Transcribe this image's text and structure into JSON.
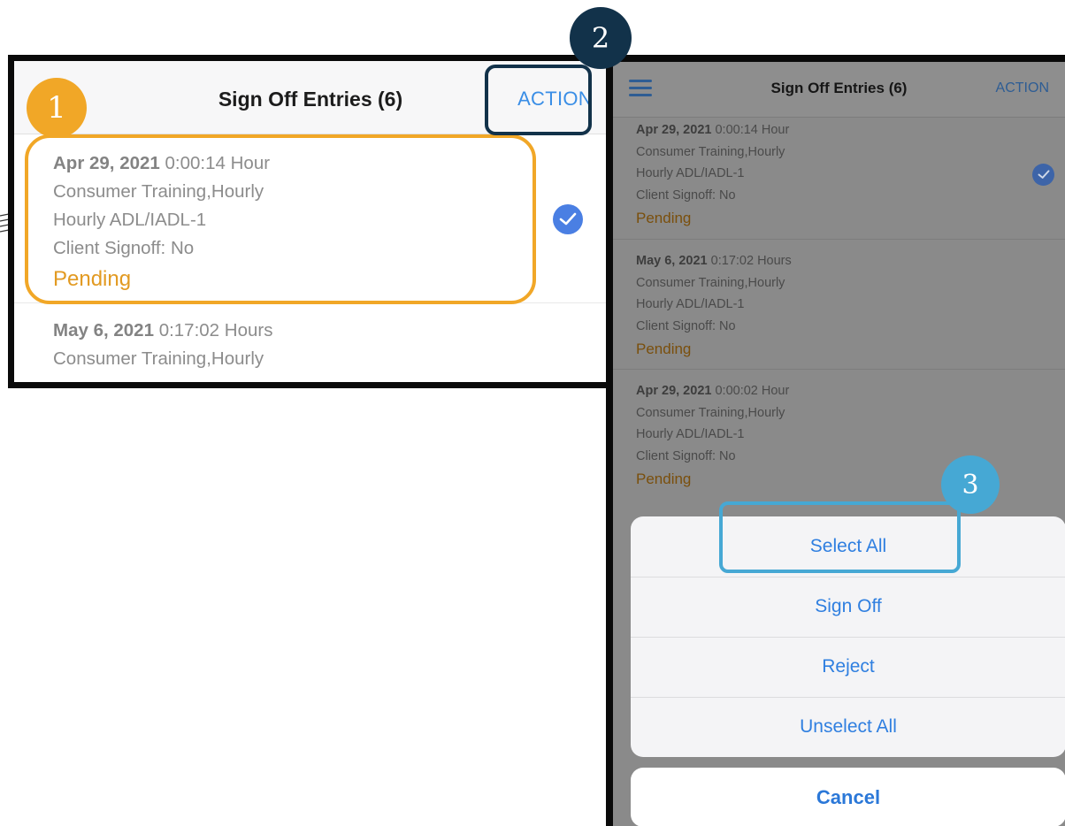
{
  "left_panel": {
    "title": "Sign Off Entries (6)",
    "action_label": "ACTION",
    "entries": [
      {
        "date": "Apr 29, 2021",
        "duration": "0:00:14 Hour",
        "line1": "Consumer Training,Hourly",
        "line2": "Hourly ADL/IADL-1",
        "line3": "Client Signoff: No",
        "status": "Pending"
      },
      {
        "date": "May 6, 2021",
        "duration": "0:17:02 Hours",
        "line1": "Consumer Training,Hourly"
      }
    ]
  },
  "right_panel": {
    "title": "Sign Off Entries (6)",
    "action_label": "ACTION",
    "entries": [
      {
        "date": "Apr 29, 2021",
        "duration": "0:00:14 Hour",
        "line1": "Consumer Training,Hourly",
        "line2": "Hourly ADL/IADL-1",
        "line3": "Client Signoff: No",
        "status": "Pending"
      },
      {
        "date": "May 6, 2021",
        "duration": "0:17:02 Hours",
        "line1": "Consumer Training,Hourly",
        "line2": "Hourly ADL/IADL-1",
        "line3": "Client Signoff: No",
        "status": "Pending"
      },
      {
        "date": "Apr 29, 2021",
        "duration": "0:00:02 Hour",
        "line1": "Consumer Training,Hourly",
        "line2": "Hourly ADL/IADL-1",
        "line3": "Client Signoff: No",
        "status": "Pending"
      }
    ],
    "action_sheet": {
      "options": [
        "Select All",
        "Sign Off",
        "Reject",
        "Unselect All"
      ],
      "cancel_label": "Cancel"
    }
  },
  "badges": {
    "step1": "1",
    "step2": "2",
    "step3": "3"
  },
  "colors": {
    "step1": "#f1a727",
    "step2": "#12324a",
    "step3": "#46a8d4",
    "link_blue": "#3a8ee6",
    "pending_orange": "#e29a22",
    "check_blue": "#4a7fe3"
  },
  "icons": {
    "menu": "hamburger-menu-icon",
    "selected": "checkmark-circle-icon"
  }
}
